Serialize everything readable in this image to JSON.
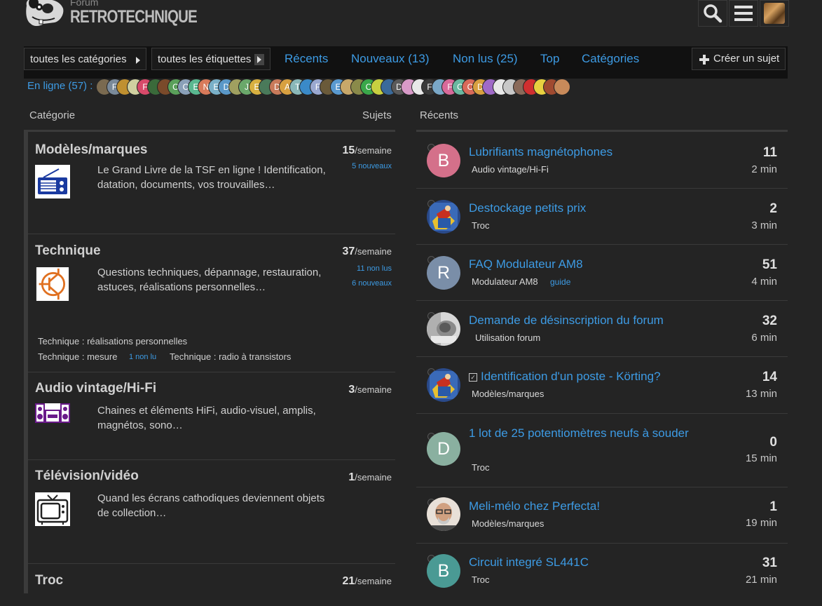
{
  "header": {
    "logo_top": "Forum",
    "logo_name": "RETROTECHNIQUE"
  },
  "nav": {
    "all_categories": "toutes les catégories",
    "all_tags": "toutes les étiquettes",
    "tabs": [
      "Récents",
      "Nouveaux (13)",
      "Non lus (25)",
      "Top",
      "Catégories"
    ],
    "create": "Créer un sujet"
  },
  "online": {
    "label": "En ligne (57) :",
    "letters": [
      "",
      "F",
      "",
      "",
      "F",
      "",
      "",
      "C",
      "C",
      "E",
      "N",
      "E",
      "D",
      "",
      "J",
      "E",
      "",
      "D",
      "A",
      "T",
      "",
      "F",
      "",
      "E",
      "",
      "",
      "C",
      "",
      "",
      "D",
      "",
      "",
      "F",
      "",
      "F",
      "C",
      "C",
      "D",
      "",
      "",
      "",
      "",
      "",
      "",
      "",
      ""
    ],
    "colors": [
      "#7a6a50",
      "#7a8a9a",
      "#c09030",
      "#d0d0a0",
      "#d84a6a",
      "#3a6a3a",
      "#7a4a2a",
      "#5aa05a",
      "#8aa0b8",
      "#5ab890",
      "#d87a5a",
      "#7ab0c8",
      "#5a98c8",
      "#a0a060",
      "#6aa86a",
      "#d8b040",
      "#4a7a5a",
      "#c87a5a",
      "#d8a040",
      "#8ab8b8",
      "#3a8ac8",
      "#9aa8d0",
      "#6a5a3a",
      "#5a9ad0",
      "#c8a86a",
      "#8a8a4a",
      "#3aa84a",
      "#c8d040",
      "#3a6a9a",
      "#5a5a5a",
      "#d89ac8",
      "#e8e8e8",
      "#3a3a3a",
      "#7aa8c8",
      "#d86a9a",
      "#6ab8a0",
      "#d86a5a",
      "#d8a040",
      "#a06ac8",
      "#e8e8e8",
      "#c8c8c8",
      "#8a6a5a",
      "#d03030",
      "#e8d040",
      "#a04a30",
      "#c88a5a"
    ]
  },
  "categories": {
    "header_name": "Catégorie",
    "header_topics": "Sujets",
    "per_week": "/semaine",
    "items": [
      {
        "name": "Modèles/marques",
        "desc": "Le Grand Livre de la TSF en ligne ! Identification, datation, documents, vos trouvailles…",
        "rate": "15",
        "new1": "5 nouveaux",
        "new2": ""
      },
      {
        "name": "Technique",
        "desc": "Questions techniques, dépannage, restauration, astuces, réalisations personnelles…",
        "rate": "37",
        "new1": "11 non lus",
        "new2": "6 nouveaux"
      },
      {
        "name": "Audio vintage/Hi-Fi",
        "desc": "Chaines et éléments HiFi, audio-visuel, amplis, magnétos, sono…",
        "rate": "3",
        "new1": "",
        "new2": ""
      },
      {
        "name": "Télévision/vidéo",
        "desc": "Quand les écrans cathodiques deviennent objets de collection…",
        "rate": "1",
        "new1": "",
        "new2": ""
      },
      {
        "name": "Troc",
        "desc": "",
        "rate": "21",
        "new1": "",
        "new2": ""
      }
    ],
    "subcats": {
      "s1": "Technique : réalisations personnelles",
      "s2": "Technique : mesure",
      "s2_badge": "1 non lu",
      "s3": "Technique : radio à transistors"
    }
  },
  "latest": {
    "header": "Récents",
    "topics": [
      {
        "avatar": "B",
        "color": "#d4708a",
        "title": "Lubrifiants magnétophones",
        "category": "Audio vintage/Hi-Fi",
        "tag": "",
        "count": "11",
        "time": "2 min"
      },
      {
        "avatar": "",
        "color": "#2a4a7a",
        "title": "Destockage petits prix",
        "category": "Troc",
        "tag": "",
        "count": "2",
        "time": "3 min"
      },
      {
        "avatar": "R",
        "color": "#7a8ea8",
        "title": "FAQ Modulateur AM8",
        "category": "Modulateur AM8",
        "tag": "guide",
        "count": "51",
        "time": "4 min"
      },
      {
        "avatar": "",
        "color": "#8a8a8a",
        "title": "Demande de désinscription du forum",
        "category": "Utilisation forum",
        "tag": "",
        "count": "32",
        "time": "6 min"
      },
      {
        "avatar": "",
        "color": "#2a4a7a",
        "title": "Identification d'un poste - Körting?",
        "category": "Modèles/marques",
        "tag": "",
        "count": "14",
        "time": "13 min"
      },
      {
        "avatar": "D",
        "color": "#8ab0a0",
        "title": "1 lot de 25 potentiomètres neufs à souder",
        "category": "Troc",
        "tag": "",
        "count": "0",
        "time": "15 min"
      },
      {
        "avatar": "",
        "color": "#b09080",
        "title": "Meli-mélo chez Perfecta!",
        "category": "Modèles/marques",
        "tag": "",
        "count": "1",
        "time": "19 min"
      },
      {
        "avatar": "B",
        "color": "#4a9a94",
        "title": "Circuit integré SL441C",
        "category": "Troc",
        "tag": "",
        "count": "31",
        "time": "21 min"
      }
    ]
  }
}
